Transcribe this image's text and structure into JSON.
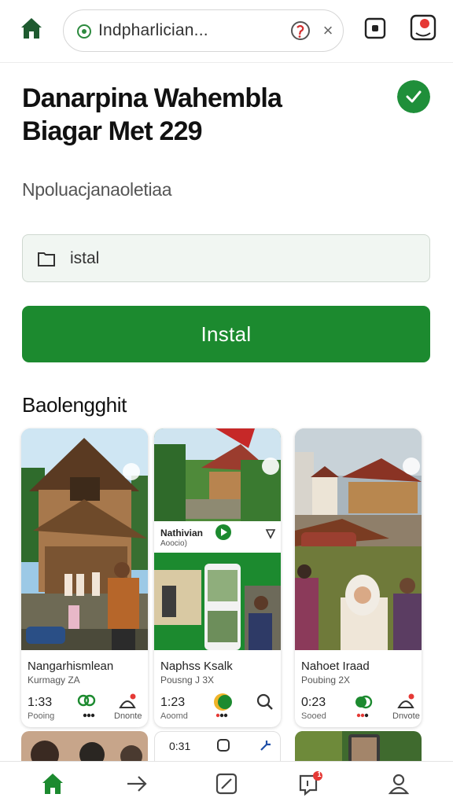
{
  "browser": {
    "url": "Indpharlician...",
    "close_glyph": "×"
  },
  "header": {
    "title_line1": "Danarpina Wahembla",
    "title_line2": "Biagar Met 229",
    "subtitle": "Npoluacjanaoletiaa"
  },
  "install": {
    "field_value": "istal",
    "button_label": "Instal"
  },
  "section": {
    "title": "Baolengghit"
  },
  "cards": [
    {
      "title": "Nangarhismlean",
      "meta": "Kurmagy ZA",
      "time": "1:33",
      "small": "Pooing",
      "icon_label": "Dnonte",
      "action_icon": "people-icon",
      "end_icon": "bell-icon",
      "inner_title": "",
      "inner_sub": ""
    },
    {
      "title": "Naphss Ksalk",
      "meta": "Pousng J 3X",
      "time": "1:23",
      "small": "Aoomd",
      "icon_label": "",
      "action_icon": "dots-icon",
      "end_icon": "search-icon",
      "inner_title": "Nathivian",
      "inner_sub": "Aoocio)"
    },
    {
      "title": "Nahoet Iraad",
      "meta": "Poubing 2X",
      "time": "0:23",
      "small": "Sooed",
      "icon_label": "Dnvote",
      "action_icon": "people-icon",
      "end_icon": "bell-icon",
      "inner_title": "",
      "inner_sub": ""
    }
  ],
  "peek_row": {
    "middle_time": "0:31"
  },
  "colors": {
    "primary_green": "#1c8a2f",
    "badge_red": "#e53935",
    "field_bg": "#f1f6f2"
  },
  "nav": {
    "items": [
      "home-icon",
      "arrow-icon",
      "edit-icon",
      "notifications-icon",
      "profile-icon"
    ],
    "notification_count": "1"
  }
}
